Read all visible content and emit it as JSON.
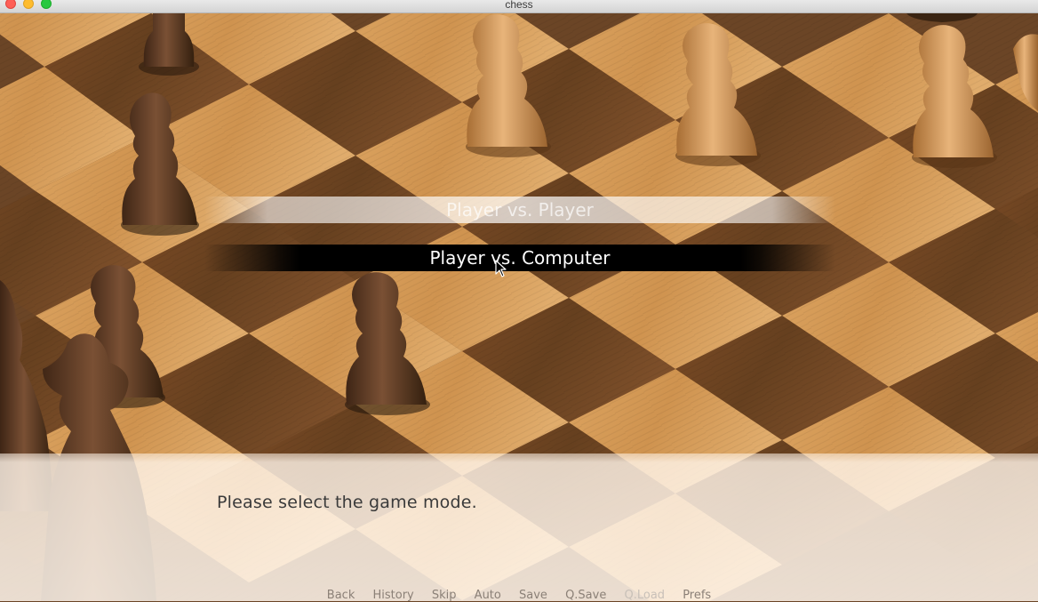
{
  "window": {
    "title": "chess"
  },
  "menu": {
    "choices": [
      {
        "label": "Player vs. Player",
        "state": "idle"
      },
      {
        "label": "Player vs. Computer",
        "state": "hover"
      }
    ]
  },
  "dialogue": {
    "text": "Please select the game mode."
  },
  "quick_menu": {
    "items": [
      {
        "label": "Back",
        "enabled": true
      },
      {
        "label": "History",
        "enabled": true
      },
      {
        "label": "Skip",
        "enabled": true
      },
      {
        "label": "Auto",
        "enabled": true
      },
      {
        "label": "Save",
        "enabled": true
      },
      {
        "label": "Q.Save",
        "enabled": true
      },
      {
        "label": "Q.Load",
        "enabled": false
      },
      {
        "label": "Prefs",
        "enabled": true
      }
    ]
  },
  "colors": {
    "light_square": "#d49a55",
    "dark_square": "#6e4322",
    "light_piece": "#c98f4e",
    "dark_piece": "#5a3a22",
    "menu_highlight": "#000000"
  }
}
